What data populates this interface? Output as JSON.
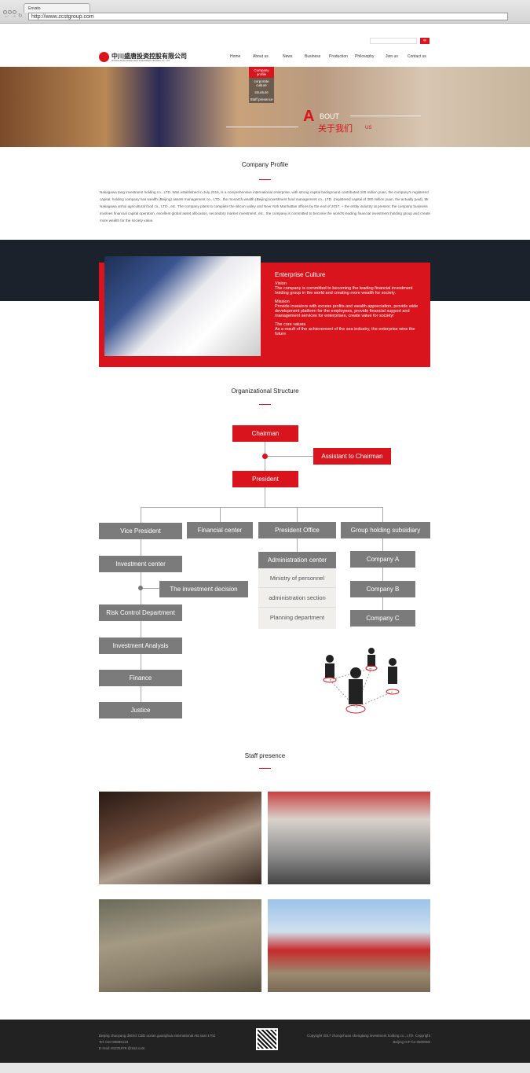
{
  "browser": {
    "tab_title": "Envato",
    "url": "http://www.zcstgroup.com"
  },
  "header": {
    "logo_cn": "中川盛唐投资控股有限公司",
    "logo_en": "ZHONGCHUAN SHENGTANG INVESTMENT HOLDING CO., LTD",
    "lang_button": "中",
    "nav": [
      "Home",
      "About us",
      "News",
      "Business",
      "Production",
      "Philosophy",
      "Jion us",
      "Contact us"
    ],
    "dropdown": [
      "Company profile",
      "corporate culture",
      "structure",
      "Staff presence"
    ]
  },
  "banner": {
    "big_letter": "A",
    "word": "BOUT",
    "cn": "关于我们",
    "us": "US"
  },
  "profile": {
    "title": "Company Profile",
    "text": "Nakagawa tang investment holding co., LTD. Was established in July 2015, is a comprehensive international enterprise, with strong capital background contributed 100 million yuan, the company's registered capital, holding company has wealth (Beijing) assets management co., LTD., the monarch wealth (Beijing) investment fund management co., LTD. (registered capital of 300 million yuan, the actually paid), Mr Nakagawa anhui agricultural food co., LTD., etc. The company plans to complete the silicon valley and New York Manhattan offices by the end of 2017. + the entity industry at present, the company business involves financial capital operation, excellent global asset allocation, secondary market investment, etc., the company is committed to become the world's leading financial investment holding group and create more wealth for the society value."
  },
  "culture": {
    "title": "Enterprise Culture",
    "items": [
      {
        "h": "Vision",
        "t": "The company is committed to becoming the leading financial investment holding group in the world and creating more wealth for society."
      },
      {
        "h": "Mission",
        "t": "Provide investors with excess profits and wealth appreciation, provide wide development platform for the employees, provide financial support and management services for enterprises, create value for society!"
      },
      {
        "h": "The core values",
        "t": "As a result of the achievement of the sea industry, the enterprise wins the future"
      }
    ]
  },
  "org": {
    "title": "Organizational Structure",
    "chairman": "Chairman",
    "assistant": "Assistant to Chairman",
    "president": "President",
    "vp": "Vice President",
    "financial": "Financial center",
    "office": "President Office",
    "group": "Group holding subsidiary",
    "vp_items": [
      "Investment center",
      "The investment decision",
      "Risk Control Department",
      "Investment Analysis",
      "Finance",
      "Justice"
    ],
    "admin": "Administration center",
    "office_items": [
      "Ministry of personnel",
      "administration section",
      "Planning department"
    ],
    "companies": [
      "Company A",
      "Company B",
      "Company C"
    ]
  },
  "staff": {
    "title": "Staff presence"
  },
  "footer": {
    "address": "Beijing chaoyang district CBD ocean guanghua International AB seat 1702",
    "tel": "Tel: 010-85886133",
    "email": "E-mail: 81231979 @163.com",
    "copyright": "Copyright 2017 zhongchuan shengtang investment holding co., LTD. Copyright",
    "icp": "Beijing ICP for 0600000"
  },
  "colors": {
    "accent": "#d9141c",
    "dark": "#1c222c",
    "box_gray": "#7b7b7b"
  }
}
